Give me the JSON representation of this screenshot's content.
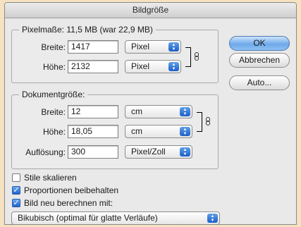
{
  "window": {
    "title": "Bildgröße"
  },
  "pixel_dims": {
    "title": "Pixelmaße: 11,5 MB (war 22,9 MB)",
    "width_label": "Breite:",
    "width_value": "1417",
    "width_unit": "Pixel",
    "height_label": "Höhe:",
    "height_value": "2132",
    "height_unit": "Pixel"
  },
  "doc_size": {
    "title": "Dokumentgröße:",
    "width_label": "Breite:",
    "width_value": "12",
    "width_unit": "cm",
    "height_label": "Höhe:",
    "height_value": "18,05",
    "height_unit": "cm",
    "res_label": "Auflösung:",
    "res_value": "300",
    "res_unit": "Pixel/Zoll"
  },
  "buttons": {
    "ok": "OK",
    "cancel": "Abbrechen",
    "auto": "Auto..."
  },
  "options": {
    "scale_styles": {
      "label": "Stile skalieren",
      "checked": false
    },
    "constrain": {
      "label": "Proportionen beibehalten",
      "checked": true
    },
    "resample": {
      "label": "Bild neu berechnen mit:",
      "checked": true
    },
    "method": "Bikubisch (optimal für glatte Verläufe)"
  },
  "colors": {
    "background": "#f6e2c0",
    "accent": "#1c5fc9"
  },
  "icons": [
    "chain-link-icon",
    "select-arrows-icon",
    "checkmark-icon"
  ]
}
